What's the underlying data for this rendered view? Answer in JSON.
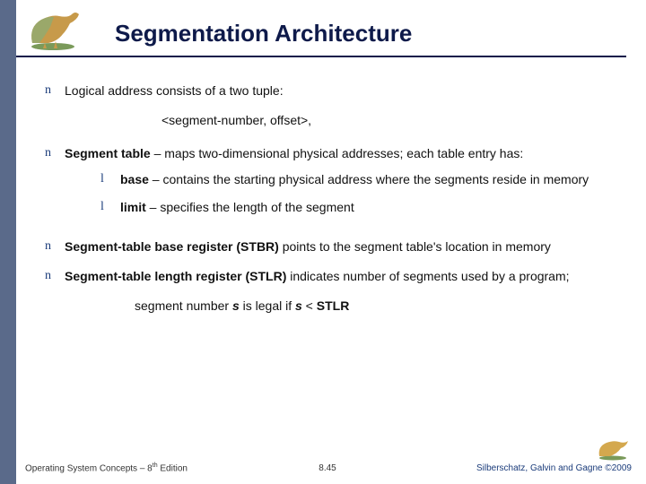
{
  "header": {
    "title": "Segmentation Architecture"
  },
  "bullets": {
    "b1": "Logical address consists of a two tuple:",
    "b1_sub": "<segment-number, offset>,",
    "b2_pre": "Segment table",
    "b2_post": " – maps two-dimensional physical addresses; each table entry has:",
    "b2a_pre": "base",
    "b2a_post": " – contains the starting physical address where the segments reside in memory",
    "b2b_pre": "limit",
    "b2b_post": " – specifies the length of the segment",
    "b3_pre": "Segment-table base register (STBR)",
    "b3_post": " points to the segment table's location in memory",
    "b4_pre": "Segment-table length register (STLR)",
    "b4_post": " indicates number of segments used by a program;",
    "b4_line2a": "segment number ",
    "b4_s1": "s",
    "b4_line2b": " is legal if ",
    "b4_s2": "s",
    "b4_line2c": " < ",
    "b4_stlr": "STLR"
  },
  "footer": {
    "left_a": "Operating System Concepts – 8",
    "left_b": "th",
    "left_c": " Edition",
    "center": "8.45",
    "right": "Silberschatz, Galvin and Gagne ©2009"
  }
}
